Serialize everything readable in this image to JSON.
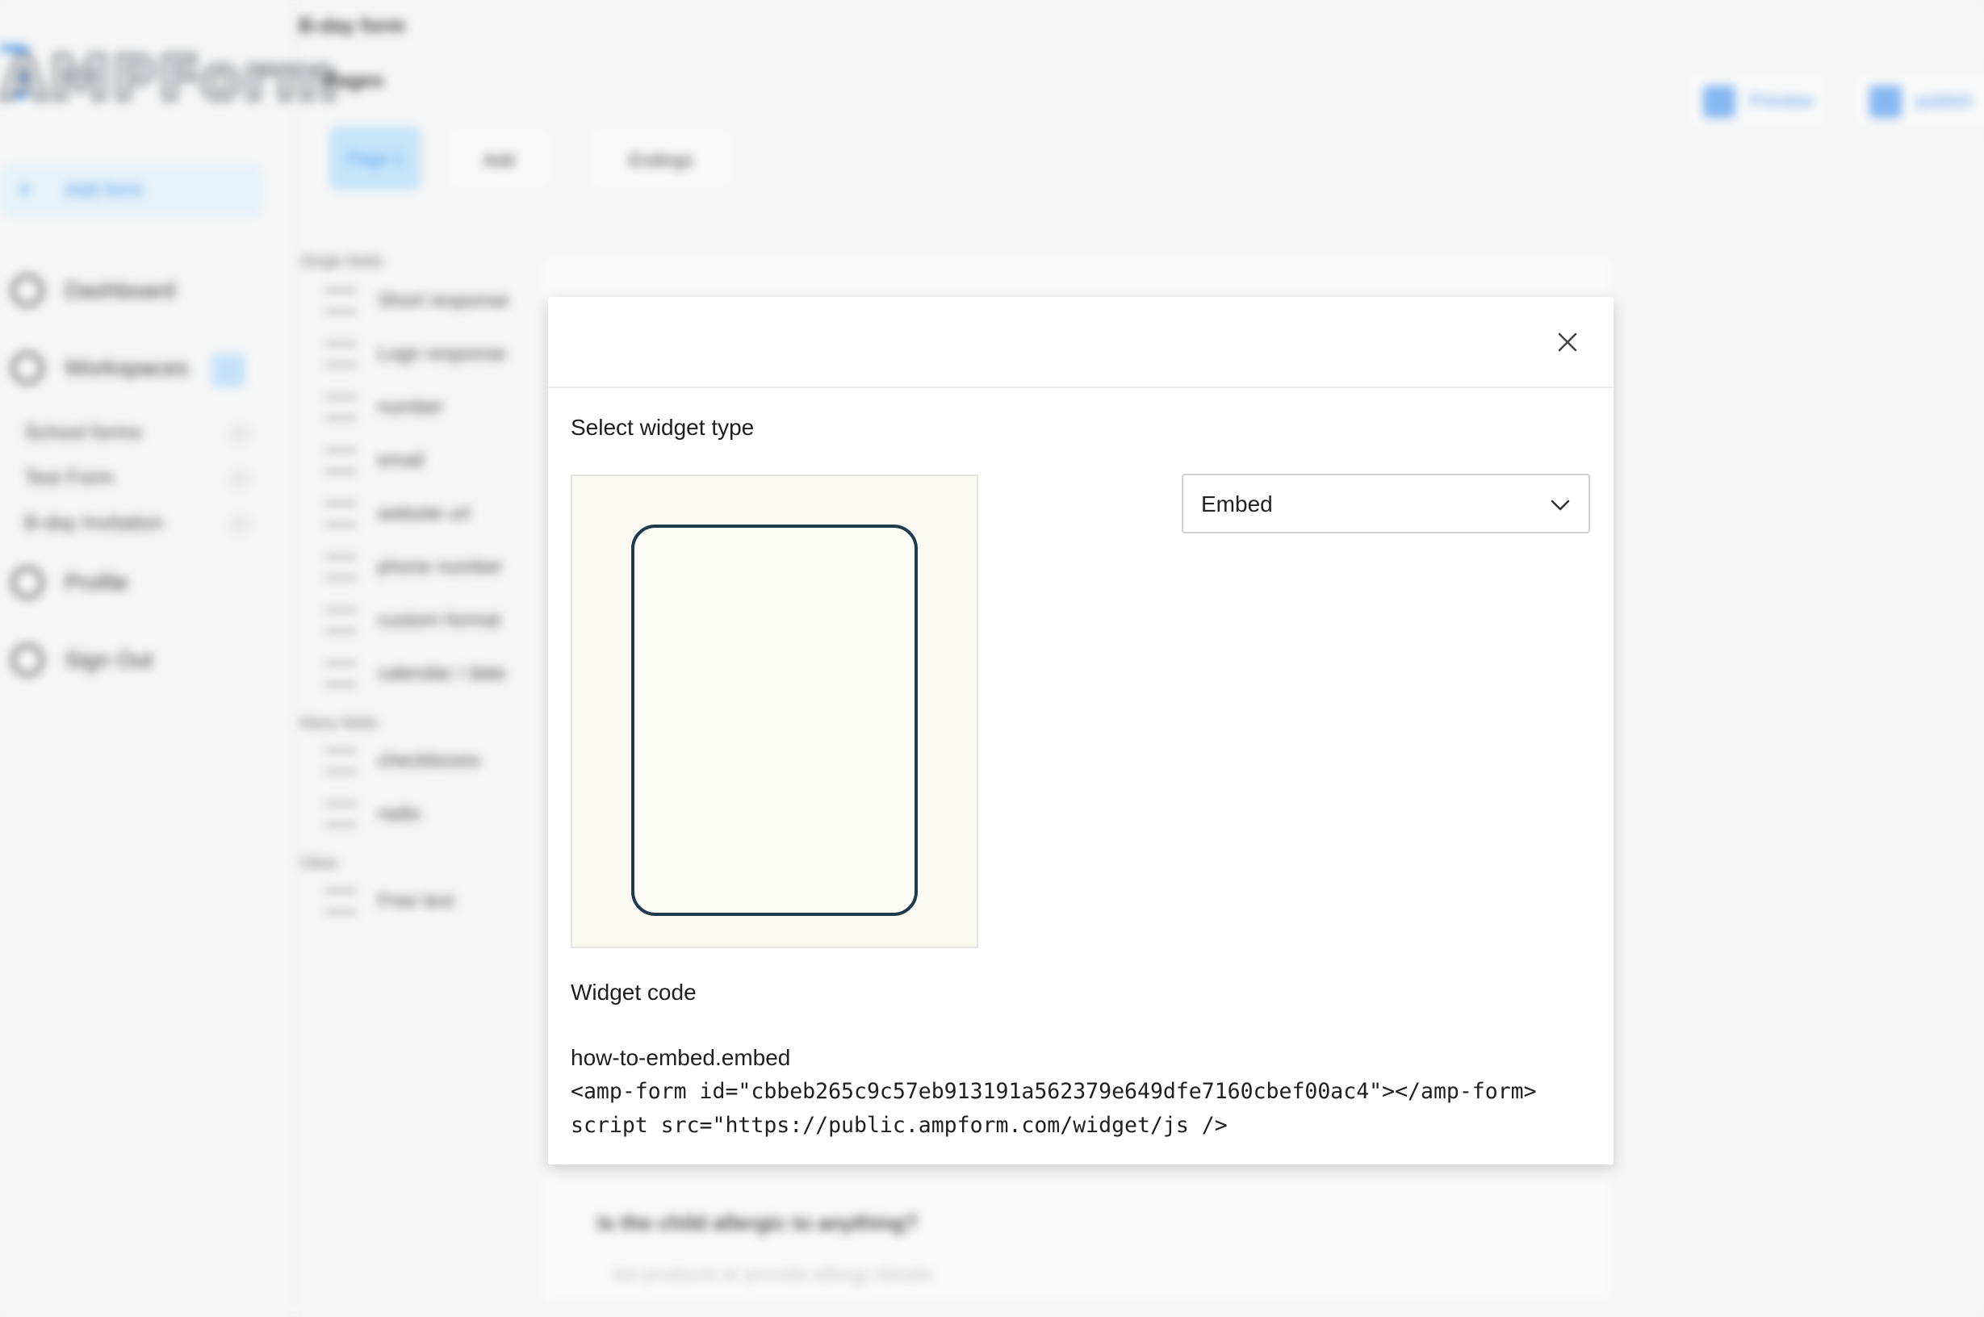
{
  "background": {
    "logo": "AMPForm",
    "form_title": "B-day form",
    "pages_label": "Pages",
    "add_form_label": "Add form",
    "nav": {
      "dashboard": "Dashboard",
      "workspaces": "Workspaces",
      "profile": "Profile",
      "sign_out": "Sign Out"
    },
    "workspace_items": [
      {
        "label": "School forms",
        "count": "11"
      },
      {
        "label": "Test Form",
        "count": "11"
      },
      {
        "label": "B-day Invitation",
        "count": "11"
      }
    ],
    "page_tabs": {
      "page1": "Page 1",
      "add": "Add",
      "endings": "Endings"
    },
    "top_buttons": {
      "preview": "Preview",
      "publish": "publish"
    },
    "palette_sections": {
      "single": "Single fields",
      "many": "Many fields",
      "other": "Other"
    },
    "palette_items": {
      "short_response": "Short response",
      "logn_response": "Logn response",
      "number": "number",
      "email": "email",
      "website_url": "website url",
      "phone_number": "phone number",
      "custom_format": "custom format",
      "calendar_date": "calendar / date",
      "checkboxes": "checkboxes",
      "radio": "radio",
      "free_text": "Free text"
    },
    "question_text": "Is the child allergic to anything?",
    "question_hint": "list products or provide allergy details"
  },
  "modal": {
    "select_widget_type_label": "Select widget type",
    "selected_widget_type": "Embed",
    "widget_code_label": "Widget code",
    "code_lines": [
      "how-to-embed.embed",
      "<amp-form id=\"cbbeb265c9c57eb913191a562379e649dfe7160cbef00ac4\"></amp-form>",
      "script src=\"https://public.ampform.com/widget/js />"
    ]
  },
  "colors": {
    "accent": "#3b8ef0",
    "preview_card_border": "#1e3a4e",
    "preview_bg": "#fafaf3"
  },
  "icons": {
    "close": "close-icon",
    "dropdown": "chevron-down-icon"
  }
}
